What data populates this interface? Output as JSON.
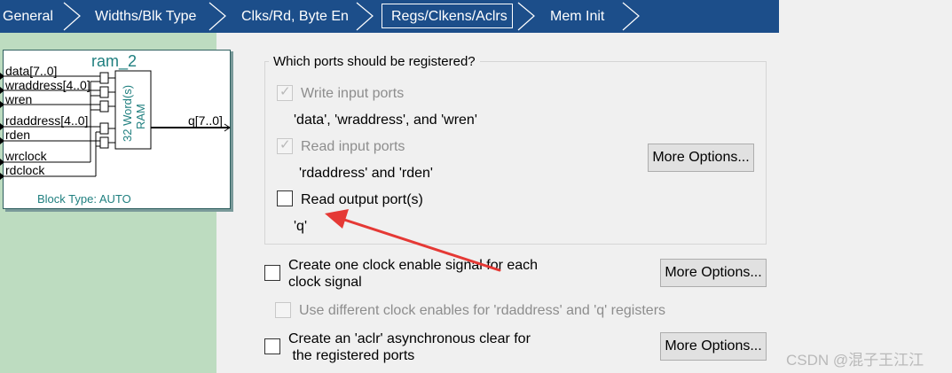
{
  "tabs": [
    {
      "label": "General"
    },
    {
      "label": "Widths/Blk Type"
    },
    {
      "label": "Clks/Rd, Byte En"
    },
    {
      "label": "Regs/Clkens/Aclrs",
      "active": true
    },
    {
      "label": "Mem Init"
    }
  ],
  "block": {
    "title": "ram_2",
    "ports_in": [
      "data[7..0]",
      "wraddress[4..0]",
      "wren",
      "rdaddress[4..0]",
      "rden",
      "wrclock",
      "rdclock"
    ],
    "port_out": "q[7..0]",
    "ram_line1": "32 Word(s)",
    "ram_line2": "RAM",
    "block_type": "Block Type: AUTO"
  },
  "registered_group": {
    "title": "Which ports should be registered?",
    "write_input": {
      "label": "Write input ports",
      "checked": true,
      "enabled": false,
      "desc": "'data', 'wraddress', and 'wren'"
    },
    "read_input": {
      "label": "Read input ports",
      "checked": true,
      "enabled": false,
      "desc": "'rdaddress' and 'rden'"
    },
    "read_output": {
      "label": "Read output port(s)",
      "checked": false,
      "enabled": true,
      "desc": "'q'"
    },
    "more_options": "More Options..."
  },
  "clock_enable": {
    "label_line1": "Create one clock enable signal for each",
    "label_line2": "clock signal",
    "checked": false,
    "more_options": "More Options..."
  },
  "diff_clock_enables": {
    "label": "Use different clock enables for 'rdaddress' and 'q' registers",
    "checked": false,
    "enabled": false
  },
  "aclr": {
    "label_line1": "Create an 'aclr' asynchronous clear for",
    "label_line2": " the registered ports",
    "checked": false,
    "more_options": "More Options..."
  },
  "watermark": "CSDN @混子王江江",
  "colors": {
    "tabbar": "#1c4e8a",
    "left_panel": "#bddcc0",
    "block_teal": "#1f7f7f",
    "arrow": "#e53935"
  }
}
